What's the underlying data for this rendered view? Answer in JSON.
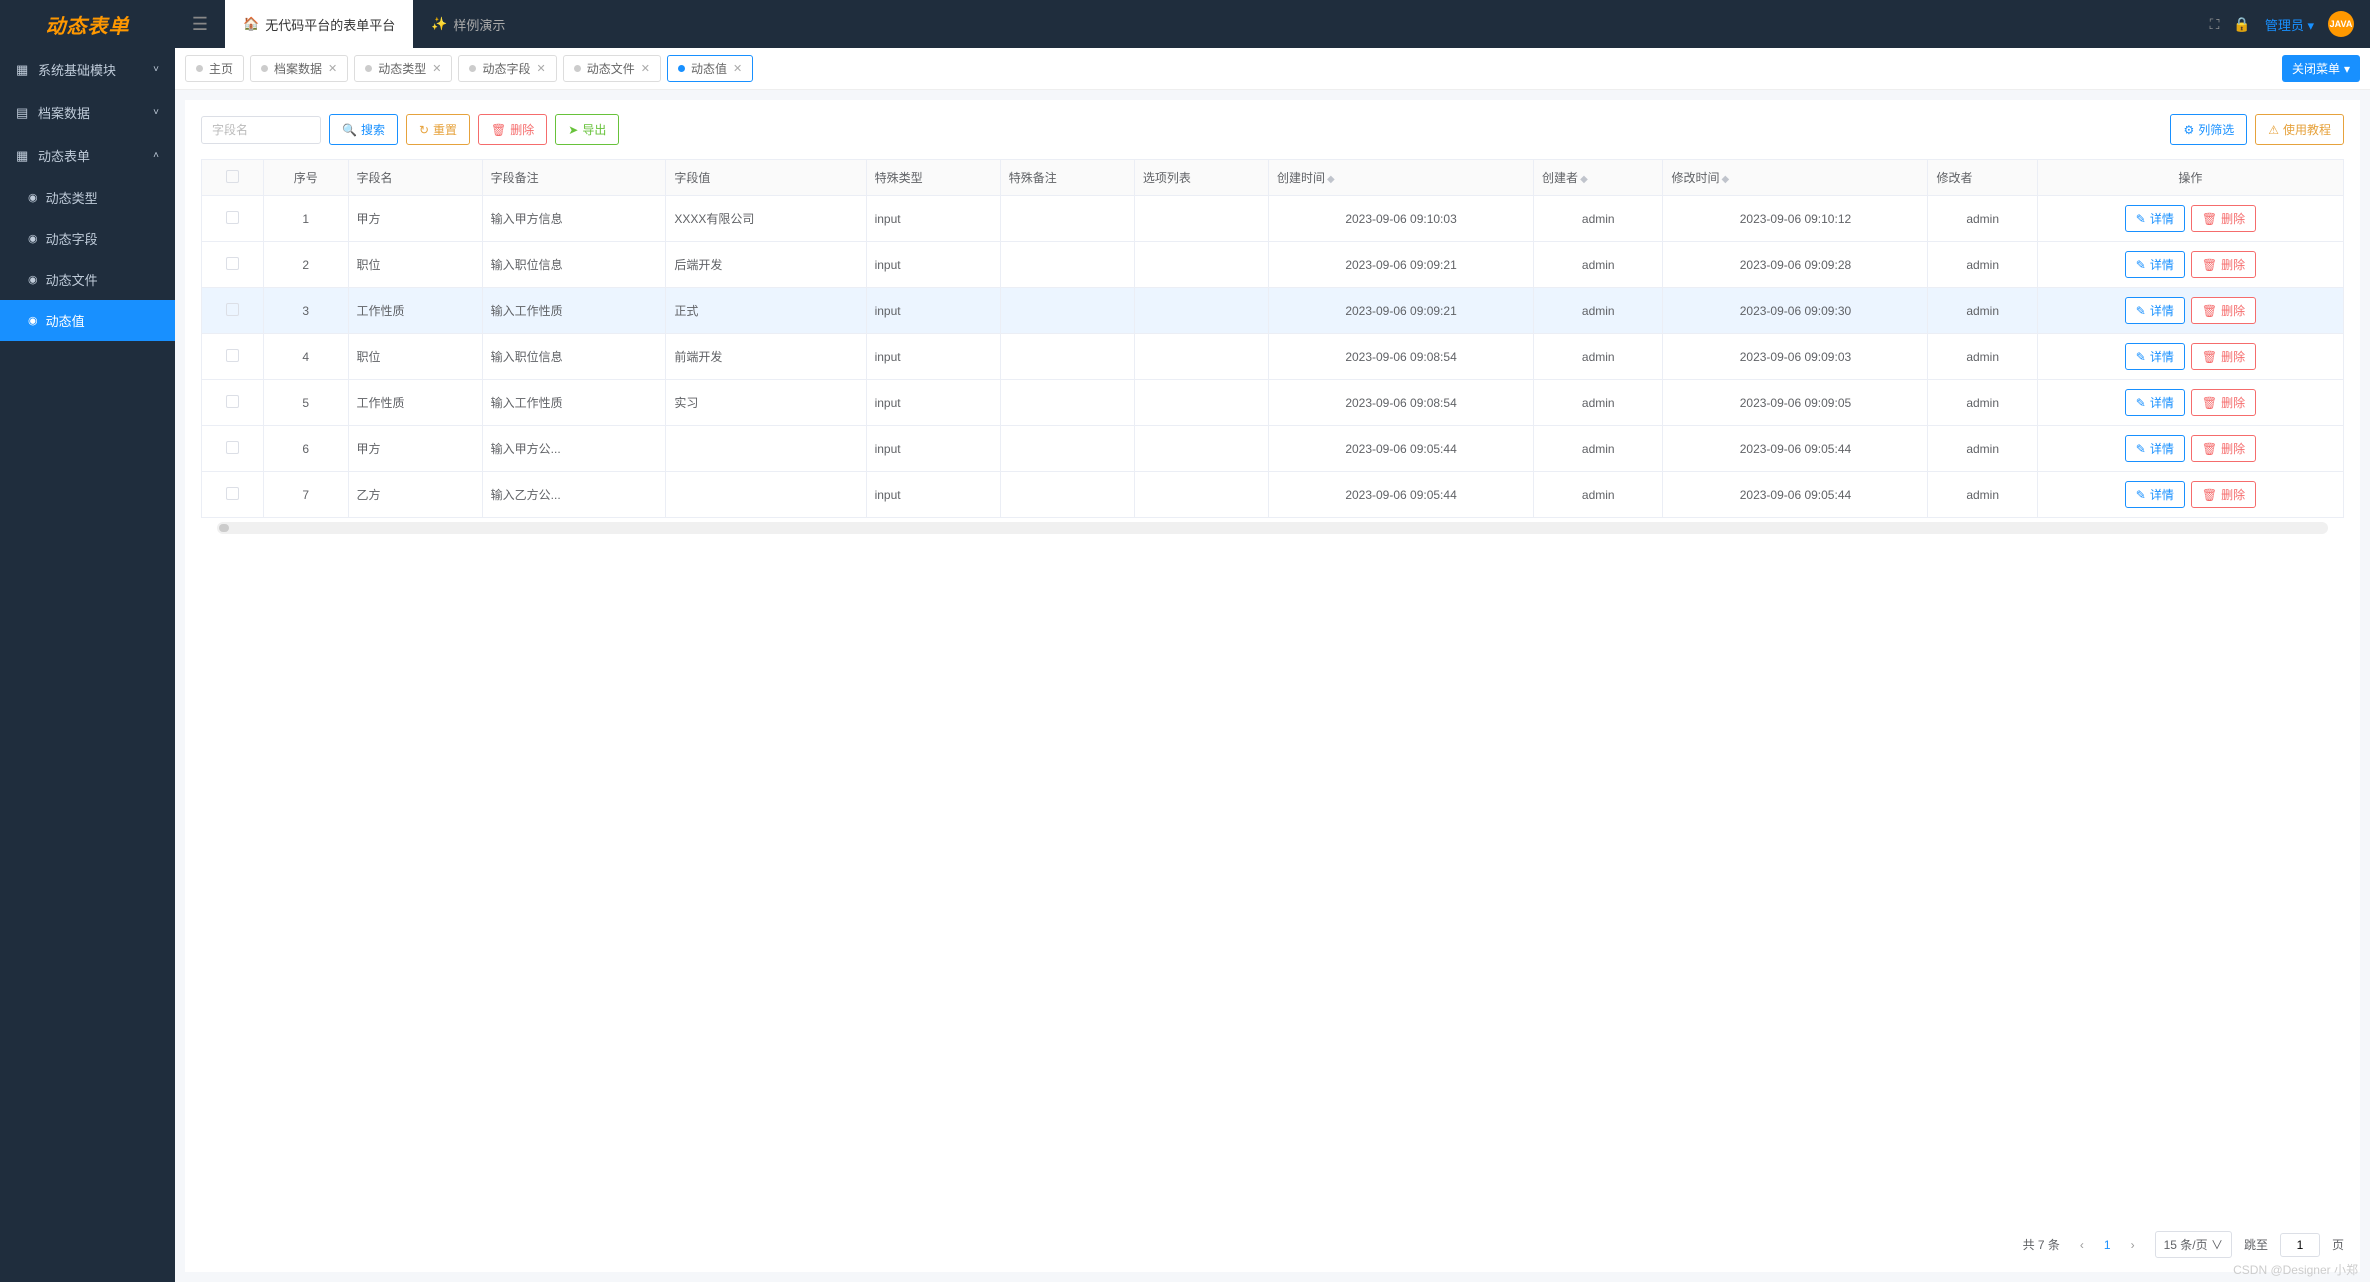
{
  "header": {
    "logo": "动态表单",
    "top_tabs": [
      {
        "icon": "🏠",
        "label": "无代码平台的表单平台",
        "active": true
      },
      {
        "icon": "✨",
        "label": "样例演示",
        "active": false
      }
    ],
    "admin_label": "管理员",
    "avatar_text": "JAVA"
  },
  "sidebar": {
    "groups": [
      {
        "icon": "▦",
        "label": "系统基础模块",
        "open": false
      },
      {
        "icon": "▤",
        "label": "档案数据",
        "open": false
      },
      {
        "icon": "▦",
        "label": "动态表单",
        "open": true,
        "children": [
          {
            "icon": "◉",
            "label": "动态类型",
            "active": false
          },
          {
            "icon": "◉",
            "label": "动态字段",
            "active": false
          },
          {
            "icon": "◉",
            "label": "动态文件",
            "active": false
          },
          {
            "icon": "◉",
            "label": "动态值",
            "active": true
          }
        ]
      }
    ]
  },
  "tags": {
    "items": [
      {
        "label": "主页",
        "active": false,
        "closable": false
      },
      {
        "label": "档案数据",
        "active": false,
        "closable": true
      },
      {
        "label": "动态类型",
        "active": false,
        "closable": true
      },
      {
        "label": "动态字段",
        "active": false,
        "closable": true
      },
      {
        "label": "动态文件",
        "active": false,
        "closable": true
      },
      {
        "label": "动态值",
        "active": true,
        "closable": true
      }
    ],
    "close_menu": "关闭菜单"
  },
  "toolbar": {
    "search_placeholder": "字段名",
    "search_btn": "搜索",
    "reset_btn": "重置",
    "delete_btn": "删除",
    "export_btn": "导出",
    "filter_btn": "列筛选",
    "help_btn": "使用教程"
  },
  "table": {
    "headers": [
      "序号",
      "字段名",
      "字段备注",
      "字段值",
      "特殊类型",
      "特殊备注",
      "选项列表",
      "创建时间",
      "创建者",
      "修改时间",
      "修改者",
      "操作"
    ],
    "detail_btn": "详情",
    "delete_btn": "删除",
    "rows": [
      {
        "idx": "1",
        "name": "甲方",
        "remark": "输入甲方信息",
        "value": "XXXX有限公司",
        "stype": "input",
        "sremark": "",
        "opts": "",
        "ctime": "2023-09-06 09:10:03",
        "cuser": "admin",
        "mtime": "2023-09-06 09:10:12",
        "muser": "admin"
      },
      {
        "idx": "2",
        "name": "职位",
        "remark": "输入职位信息",
        "value": "后端开发",
        "stype": "input",
        "sremark": "",
        "opts": "",
        "ctime": "2023-09-06 09:09:21",
        "cuser": "admin",
        "mtime": "2023-09-06 09:09:28",
        "muser": "admin"
      },
      {
        "idx": "3",
        "name": "工作性质",
        "remark": "输入工作性质",
        "value": "正式",
        "stype": "input",
        "sremark": "",
        "opts": "",
        "ctime": "2023-09-06 09:09:21",
        "cuser": "admin",
        "mtime": "2023-09-06 09:09:30",
        "muser": "admin",
        "hovered": true
      },
      {
        "idx": "4",
        "name": "职位",
        "remark": "输入职位信息",
        "value": "前端开发",
        "stype": "input",
        "sremark": "",
        "opts": "",
        "ctime": "2023-09-06 09:08:54",
        "cuser": "admin",
        "mtime": "2023-09-06 09:09:03",
        "muser": "admin"
      },
      {
        "idx": "5",
        "name": "工作性质",
        "remark": "输入工作性质",
        "value": "实习",
        "stype": "input",
        "sremark": "",
        "opts": "",
        "ctime": "2023-09-06 09:08:54",
        "cuser": "admin",
        "mtime": "2023-09-06 09:09:05",
        "muser": "admin"
      },
      {
        "idx": "6",
        "name": "甲方",
        "remark": "输入甲方公...",
        "value": "",
        "stype": "input",
        "sremark": "",
        "opts": "",
        "ctime": "2023-09-06 09:05:44",
        "cuser": "admin",
        "mtime": "2023-09-06 09:05:44",
        "muser": "admin"
      },
      {
        "idx": "7",
        "name": "乙方",
        "remark": "输入乙方公...",
        "value": "",
        "stype": "input",
        "sremark": "",
        "opts": "",
        "ctime": "2023-09-06 09:05:44",
        "cuser": "admin",
        "mtime": "2023-09-06 09:05:44",
        "muser": "admin"
      }
    ]
  },
  "pagination": {
    "total_text": "共 7 条",
    "current": "1",
    "page_size": "15 条/页",
    "goto_label": "跳至",
    "goto_value": "1",
    "page_suffix": "页"
  },
  "watermark": "CSDN @Designer 小郑"
}
